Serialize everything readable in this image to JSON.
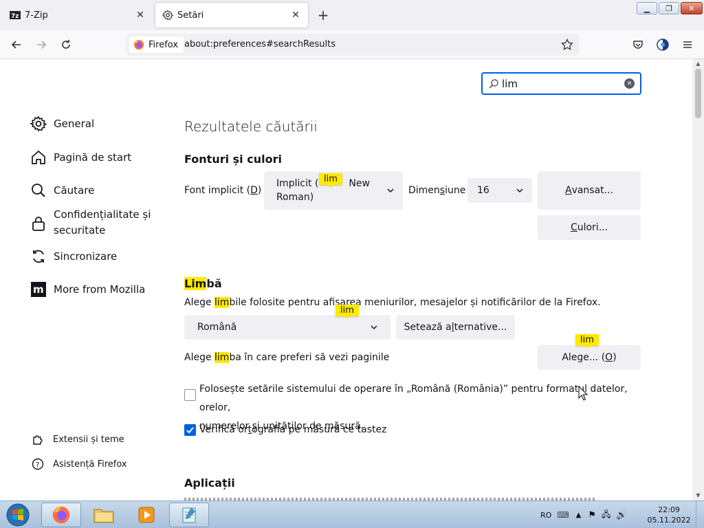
{
  "tabs": [
    {
      "title": "7-Zip",
      "icon": "7zip-icon"
    },
    {
      "title": "Setări",
      "icon": "gear-icon",
      "active": true
    }
  ],
  "window": {
    "minimize": "▁",
    "maximize": "❐",
    "close": "✕"
  },
  "navbar": {
    "identity_label": "Firefox",
    "url": "about:preferences#searchResults"
  },
  "search": {
    "value": "lim"
  },
  "sidebar": {
    "items": [
      {
        "label": "General",
        "icon": "gear-icon"
      },
      {
        "label": "Pagină de start",
        "icon": "home-icon"
      },
      {
        "label": "Căutare",
        "icon": "search-icon"
      },
      {
        "label": "Confidențialitate și securitate",
        "label_line1": "Confidențialitate și",
        "label_line2": "securitate",
        "icon": "lock-icon"
      },
      {
        "label": "Sincronizare",
        "icon": "sync-icon"
      },
      {
        "label": "More from Mozilla",
        "icon": "mozilla-icon"
      }
    ],
    "bottom": [
      {
        "label": "Extensii și teme",
        "icon": "puzzle-icon"
      },
      {
        "label": "Asistență Firefox",
        "icon": "help-icon"
      }
    ]
  },
  "main": {
    "title": "Rezultatele căutării",
    "fonts": {
      "heading": "Fonturi și culori",
      "default_font_label_prefix": "Font implicit (",
      "default_font_label_key": "D",
      "default_font_label_suffix": ")",
      "font_value_line1_a": "Implicit (",
      "font_value_line1_b": "New",
      "font_value_line2": "Roman)",
      "size_label_a": "Dimen",
      "size_label_key": "s",
      "size_label_b": "iune",
      "size_value": "16",
      "advanced_button_key": "A",
      "advanced_button_rest": "vansat...",
      "colors_button_key": "C",
      "colors_button_rest": "ulori..."
    },
    "language": {
      "heading_hl": "Lim",
      "heading_rest": "bă",
      "desc_a": "Alege ",
      "desc_hl": "lim",
      "desc_b": "bile folosite pentru afișarea meniurilor, mesajelor și notificărilor de la Firefox.",
      "selected_language": "Română",
      "alternatives_button_a": "Setează a",
      "alternatives_button_key": "l",
      "alternatives_button_b": "ternative...",
      "pages_desc_a": "Alege ",
      "pages_desc_hl": "lim",
      "pages_desc_b": "ba în care preferi să vezi paginile",
      "choose_button_a": "Alege... (",
      "choose_button_key": "O",
      "choose_button_b": ")",
      "os_locale_line1": "Folosește setările sistemului de operare în „Română (România)” pentru formatul datelor, orelor,",
      "os_locale_line2": "numerelor și unităților de măsură.",
      "spellcheck_a": "Verifică or",
      "spellcheck_key": "t",
      "spellcheck_b": "ografia pe măsură ce tastez",
      "spellcheck_checked": true,
      "os_locale_checked": false
    },
    "apps": {
      "heading": "Aplicații"
    },
    "tooltips": [
      "lim",
      "lim",
      "lim"
    ]
  },
  "taskbar": {
    "language": "RO",
    "time": "22:09",
    "date": "05.11.2022"
  },
  "colors": {
    "accent": "#0061e0",
    "highlight": "#ffe900",
    "tabbar": "#f0f0f4"
  }
}
